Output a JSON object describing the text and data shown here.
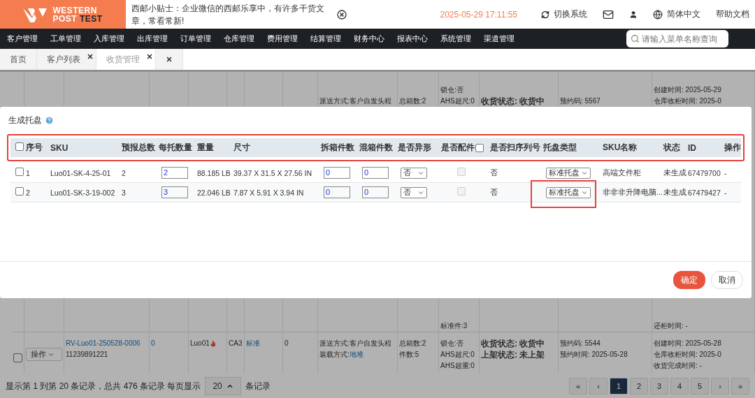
{
  "header": {
    "logo": {
      "line1": "WESTERN",
      "line2_light": "POST",
      "line2_dark": "TEST"
    },
    "notice": "西邮小贴士：企业微信的西邮乐享中，有许多干货文章，常看常新!",
    "datetime": "2025-05-29 17:11:55",
    "switch_system": "切换系统",
    "language": "简体中文",
    "help": "帮助文档"
  },
  "nav": {
    "items": [
      "客户管理",
      "工单管理",
      "入库管理",
      "出库管理",
      "订单管理",
      "仓库管理",
      "费用管理",
      "结算管理",
      "财务中心",
      "报表中心",
      "系统管理",
      "渠道管理"
    ],
    "search": {
      "placeholder": "请输入菜单名称查询"
    }
  },
  "tabs": [
    {
      "label": "首页",
      "closable": false,
      "selected": false
    },
    {
      "label": "客户列表",
      "closable": true,
      "selected": false
    },
    {
      "label": "收货管理",
      "closable": true,
      "selected": true
    },
    {
      "closable": true,
      "selected": false
    }
  ],
  "background_rows": [
    {
      "cells": [
        {},
        {},
        {},
        {},
        {},
        {},
        {},
        {},
        {
          "top": [
            {
              "kind": "text",
              "text": "派送方式:客户自发头程"
            }
          ]
        },
        {
          "top": [
            {
              "kind": "text",
              "text": "总箱数:2"
            }
          ]
        },
        {
          "top": [
            {
              "kind": "text",
              "text": "锁仓:否"
            },
            {
              "kind": "text",
              "text": "AHS超尺:0"
            }
          ],
          "bottom": [
            {
              "kind": "text",
              "text": "标准件:3"
            }
          ]
        },
        {
          "top": [
            {
              "kind": "status",
              "text": "收货状态: 收货中"
            }
          ]
        },
        {
          "top": [
            {
              "kind": "text",
              "text": "预约码: 5567"
            }
          ]
        },
        {
          "top": [
            {
              "kind": "text",
              "text": "创建时间: 2025-05-29"
            },
            {
              "kind": "text",
              "text": "仓库收柜时间: 2025-0"
            }
          ],
          "bottom": [
            {
              "kind": "text",
              "text": "还柜时间: -"
            }
          ]
        }
      ]
    },
    {
      "cells": [
        {
          "top": [
            {
              "kind": "checkbox",
              "checked": false
            }
          ]
        },
        {
          "top": [
            {
              "kind": "button",
              "text": "操作"
            }
          ]
        },
        {
          "top": [
            {
              "kind": "link",
              "text": "RV-Luo01-250528-0006"
            },
            {
              "kind": "text",
              "text": "11239891221"
            }
          ]
        },
        {
          "top": [
            {
              "kind": "link",
              "text": "0"
            }
          ]
        },
        {
          "top": [
            {
              "kind": "flagged",
              "text": "Luo01"
            }
          ]
        },
        {
          "top": [
            {
              "kind": "text",
              "text": "CA3"
            }
          ]
        },
        {
          "top": [
            {
              "kind": "link",
              "text": "标准"
            }
          ]
        },
        {
          "top": [
            {
              "kind": "text",
              "text": "0"
            }
          ]
        },
        {
          "top": [
            {
              "kind": "text",
              "text": "派送方式:客户自发头程"
            },
            {
              "kind": "labeled_link",
              "label": "装载方式:",
              "text": "地堆"
            }
          ]
        },
        {
          "top": [
            {
              "kind": "text",
              "text": "总箱数:2"
            },
            {
              "kind": "text",
              "text": "件数:5"
            }
          ]
        },
        {
          "top": [
            {
              "kind": "text",
              "text": "锁仓:否"
            },
            {
              "kind": "text",
              "text": "AHS超尺:0"
            },
            {
              "kind": "text",
              "text": "AHS超重:0"
            }
          ]
        },
        {
          "top": [
            {
              "kind": "status",
              "text": "收货状态: 收货中"
            },
            {
              "kind": "status",
              "text": "上架状态: 未上架"
            }
          ]
        },
        {
          "top": [
            {
              "kind": "text",
              "text": "预约码: 5544"
            },
            {
              "kind": "text",
              "text": "预约时间: 2025-05-28"
            }
          ]
        },
        {
          "top": [
            {
              "kind": "text",
              "text": "创建时间: 2025-05-28"
            },
            {
              "kind": "text",
              "text": "仓库收柜时间: 2025-0"
            },
            {
              "kind": "text",
              "text": "收货完成时间: -"
            }
          ]
        }
      ]
    }
  ],
  "dialog": {
    "title": "生成托盘",
    "header_highlighted": true,
    "columns": [
      {
        "kind": "checkbox",
        "checked": false
      },
      {
        "kind": "text",
        "label": "序号"
      },
      {
        "kind": "text",
        "label": "SKU"
      },
      {
        "kind": "text",
        "label": "预报总数"
      },
      {
        "kind": "text",
        "label": "每托数量"
      },
      {
        "kind": "text",
        "label": "重量"
      },
      {
        "kind": "text",
        "label": "尺寸"
      },
      {
        "kind": "text",
        "label": "拆箱件数"
      },
      {
        "kind": "text",
        "label": "混箱件数"
      },
      {
        "kind": "text",
        "label": "是否异形"
      },
      {
        "kind": "text_checkbox",
        "label": "是否配件",
        "checked": false
      },
      {
        "kind": "text",
        "label": "是否扫序列号"
      },
      {
        "kind": "text",
        "label": "托盘类型"
      },
      {
        "kind": "text",
        "label": "SKU名称"
      },
      {
        "kind": "text",
        "label": "状态"
      },
      {
        "kind": "text",
        "label": "ID"
      },
      {
        "kind": "text",
        "label": "操作"
      }
    ],
    "rows": [
      {
        "checked": false,
        "index": "1",
        "sku": "Luo01-SK-4-25-01",
        "forecast_total": "2",
        "per_pallet": "2",
        "weight": "88.185 LB",
        "size": "39.37 X 31.5 X 27.56 IN",
        "split_qty": "0",
        "mixed_qty": "0",
        "irregular": "否",
        "accessory_checked": false,
        "accessory_disabled": true,
        "serial_scan": "否",
        "pallet_type": "标准托盘",
        "pallet_type_highlighted": false,
        "sku_name": "高端文件柜",
        "status": "未生成",
        "id": "67479700",
        "action": "-"
      },
      {
        "checked": false,
        "index": "2",
        "sku": "Luo01-SK-3-19-002",
        "forecast_total": "3",
        "per_pallet": "3",
        "weight": "22.046 LB",
        "size": "7.87 X 5.91 X 3.94 IN",
        "split_qty": "0",
        "mixed_qty": "0",
        "irregular": "否",
        "accessory_checked": false,
        "accessory_disabled": true,
        "serial_scan": "否",
        "pallet_type": "标准托盘",
        "pallet_type_highlighted": true,
        "sku_name": "非非非升降电脑...",
        "status": "未生成",
        "id": "67479427",
        "action": "-"
      }
    ],
    "buttons": {
      "confirm": "确定",
      "cancel": "取消"
    }
  },
  "pagination": {
    "summary": "显示第 1 到第 20 条记录，总共 476 条记录 每页显示",
    "page_size": "20",
    "suffix": "条记录",
    "pages": [
      {
        "label": "«",
        "selected": false
      },
      {
        "label": "‹",
        "selected": false
      },
      {
        "label": "1",
        "selected": true
      },
      {
        "label": "2",
        "selected": false
      },
      {
        "label": "3",
        "selected": false
      },
      {
        "label": "4",
        "selected": false
      },
      {
        "label": "5",
        "selected": false
      },
      {
        "label": "›",
        "selected": false
      },
      {
        "label": "»",
        "selected": false
      }
    ]
  }
}
